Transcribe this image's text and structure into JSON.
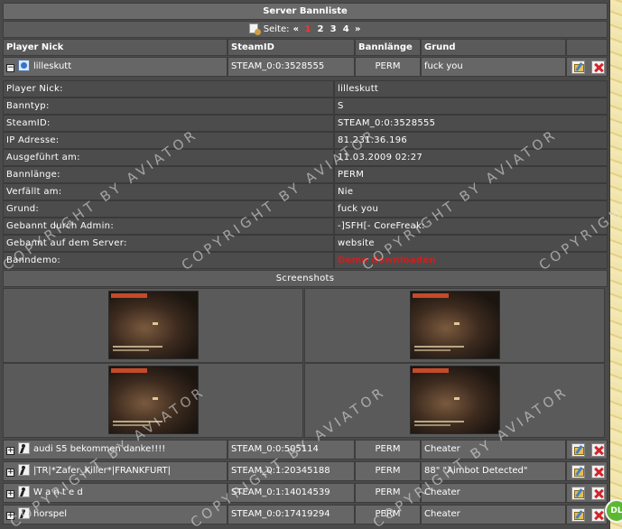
{
  "title": "Server Bannliste",
  "pager": {
    "label": "Seite:",
    "prev": "«",
    "next": "»",
    "pages": [
      "1",
      "2",
      "3",
      "4"
    ],
    "active_page": "1"
  },
  "columns": {
    "player_nick": "Player Nick",
    "steamid": "SteamID",
    "bannlaenge": "Bannlänge",
    "grund": "Grund"
  },
  "expanded_ban": {
    "nick": "lilleskutt",
    "steamid": "STEAM_0:0:3528555",
    "length": "PERM",
    "reason": "fuck you",
    "toggle": "−"
  },
  "details": [
    {
      "label": "Player Nick:",
      "value": "lilleskutt"
    },
    {
      "label": "Banntyp:",
      "value": "S"
    },
    {
      "label": "SteamID:",
      "value": "STEAM_0:0:3528555"
    },
    {
      "label": "IP Adresse:",
      "value": "81.231.36.196"
    },
    {
      "label": "Ausgeführt am:",
      "value": "11.03.2009 02:27"
    },
    {
      "label": "Bannlänge:",
      "value": "PERM"
    },
    {
      "label": "Verfällt am:",
      "value": "Nie"
    },
    {
      "label": "Grund:",
      "value": "fuck you"
    },
    {
      "label": "Gebannt durch Admin:",
      "value": "-]SFH[- CoreFreak:"
    },
    {
      "label": "Gebannt auf dem Server:",
      "value": "website"
    },
    {
      "label": "Banndemo:",
      "value": "Demo downloaden"
    }
  ],
  "screenshots_title": "Screenshots",
  "bans": [
    {
      "nick": "audi S5 bekommen danke!!!!",
      "steamid": "STEAM_0:0:505114",
      "length": "PERM",
      "reason": "Cheater",
      "toggle": "+"
    },
    {
      "nick": "|TR|*Zafer_Killer*|FRANKFURT|",
      "steamid": "STEAM_0:1:20345188",
      "length": "PERM",
      "reason": "88\" \"Aimbot Detected\"",
      "toggle": "+"
    },
    {
      "nick": "W a n t e d",
      "steamid": "STEAM_0:1:14014539",
      "length": "PERM",
      "reason": "Cheater",
      "toggle": "+"
    },
    {
      "nick": "horspel",
      "steamid": "STEAM_0:0:17419294",
      "length": "PERM",
      "reason": "Cheater",
      "toggle": "+"
    }
  ],
  "watermark": "COPYRIGHT BY AVIATOR",
  "watermark_short": "COPYRIGHT",
  "corner_badge": "DL",
  "icons": {
    "page_icon": "page-icon",
    "user_icon": "user-icon",
    "edit_icon": "edit-icon",
    "delete_icon": "delete-icon"
  },
  "colors": {
    "active_page": "#ff3030",
    "demo_link": "#d21d1d"
  }
}
